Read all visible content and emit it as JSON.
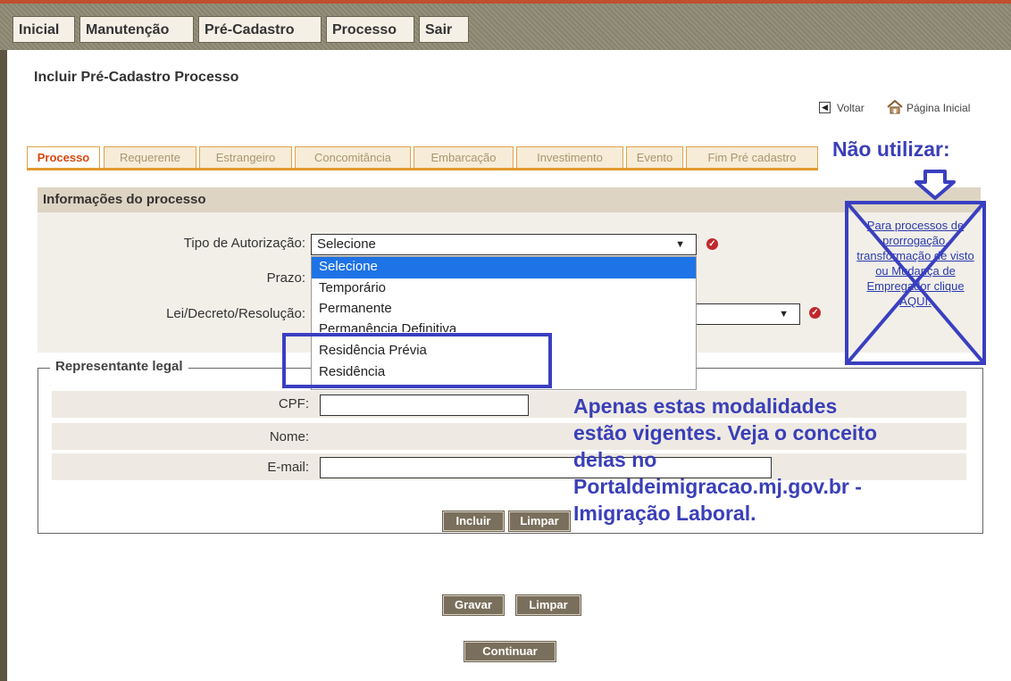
{
  "menu": [
    "Inicial",
    "Manutenção",
    "Pré-Cadastro",
    "Processo",
    "Sair"
  ],
  "page_title": "Incluir Pré-Cadastro Processo",
  "links": {
    "back": "Voltar",
    "home": "Página Inicial"
  },
  "tabs": [
    "Processo",
    "Requerente",
    "Estrangeiro",
    "Concomitância",
    "Embarcação",
    "Investimento",
    "Evento",
    "Fim Pré cadastro"
  ],
  "section_title": "Informações do processo",
  "fields": {
    "tipo_label": "Tipo de Autorização:",
    "tipo_value": "Selecione",
    "prazo_label": "Prazo:",
    "lei_label": "Lei/Decreto/Resolução:"
  },
  "dropdown_options": [
    "Selecione",
    "Temporário",
    "Permanente",
    "Permanência Definitiva",
    "Residência Prévia",
    "Residência"
  ],
  "representante": {
    "legend": "Representante legal",
    "cpf_label": "CPF:",
    "nome_label": "Nome:",
    "email_label": "E-mail:",
    "incluir": "Incluir",
    "limpar": "Limpar"
  },
  "buttons": {
    "gravar": "Gravar",
    "limpar": "Limpar",
    "continuar": "Continuar"
  },
  "annotations": {
    "nao_utilizar": "Não utilizar:",
    "link_text": "Para processos de prorrogação, transformação de visto ou Mudança de Empregador clique AQUI.",
    "note_lines": [
      "Apenas estas modalidades",
      "estão vigentes. Veja o conceito",
      "delas no",
      "Portaldeimigracao.mj.gov.br -",
      "Imigração Laboral."
    ]
  },
  "colors": {
    "annotation": "#3a3fb8",
    "tab_border": "#e39a2f",
    "active_tab": "#d9480f",
    "button": "#7a6f5c",
    "selected_option": "#1e73e6"
  }
}
